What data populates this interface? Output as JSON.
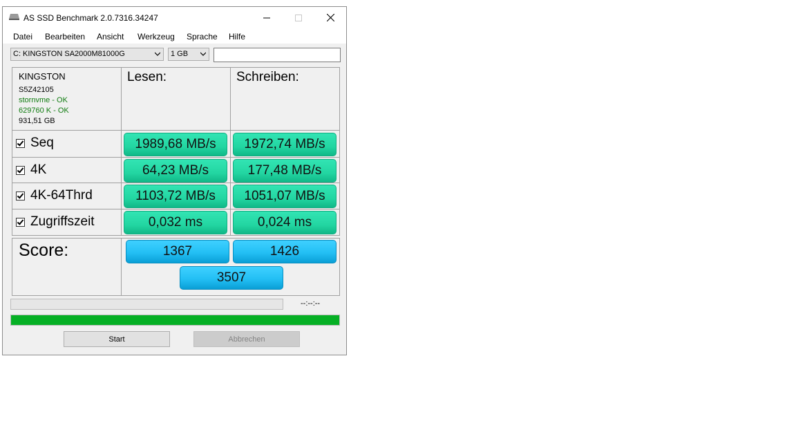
{
  "window": {
    "title": "AS SSD Benchmark 2.0.7316.34247",
    "controls": {
      "minimize": "minimize-icon",
      "maximize": "maximize-icon",
      "close": "close-icon"
    }
  },
  "menu": [
    "Datei",
    "Bearbeiten",
    "Ansicht",
    "Werkzeug",
    "Sprache",
    "Hilfe"
  ],
  "drive_select": "C: KINGSTON SA2000M81000G",
  "size_select": "1 GB",
  "text_field": "",
  "drive_info": {
    "name": "KINGSTON",
    "serial": "S5Z42105",
    "driver": "stornvme - OK",
    "alignment": "629760 K - OK",
    "capacity": "931,51 GB"
  },
  "columns": {
    "read": "Lesen:",
    "write": "Schreiben:"
  },
  "tests": [
    {
      "label": "Seq",
      "read": "1989,68 MB/s",
      "write": "1972,74 MB/s"
    },
    {
      "label": "4K",
      "read": "64,23 MB/s",
      "write": "177,48 MB/s"
    },
    {
      "label": "4K-64Thrd",
      "read": "1103,72 MB/s",
      "write": "1051,07 MB/s"
    },
    {
      "label": "Zugriffszeit",
      "read": "0,032 ms",
      "write": "0,024 ms"
    }
  ],
  "score": {
    "label": "Score:",
    "read": "1367",
    "write": "1426",
    "total": "3507"
  },
  "progress": {
    "time": "--:--:--",
    "current_fraction": 0,
    "total_fraction": 1
  },
  "buttons": {
    "start": "Start",
    "abort": "Abbrechen"
  },
  "colors": {
    "result": "#23d6a2",
    "score": "#23bff4",
    "progress": "#06b025",
    "ok_text": "#117c11"
  }
}
